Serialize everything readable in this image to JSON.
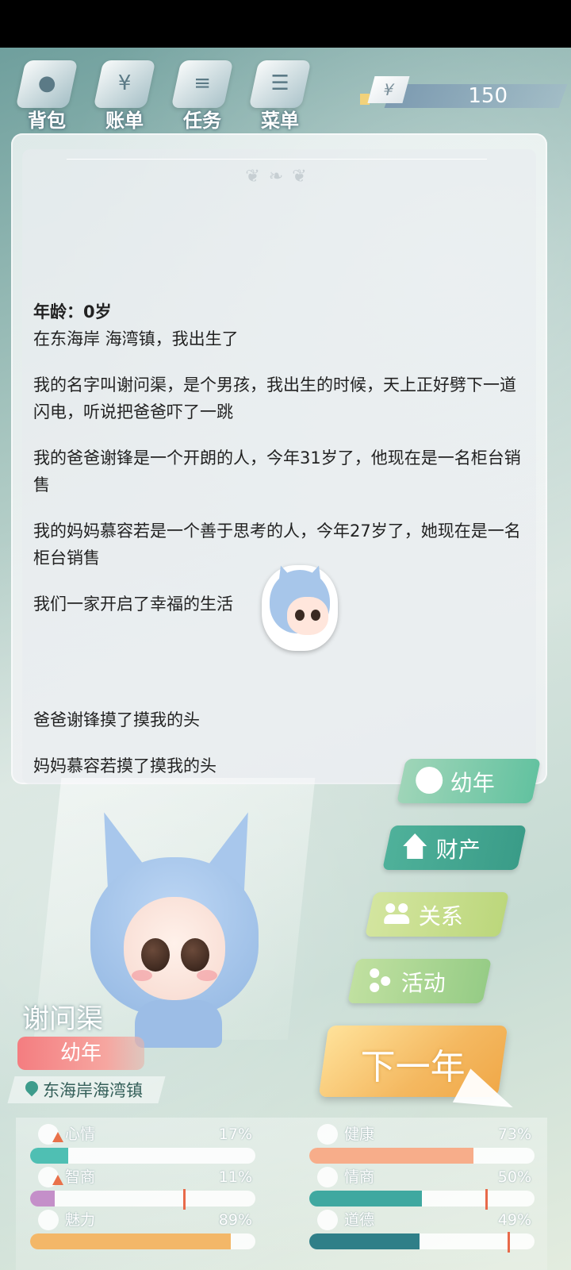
{
  "nav": {
    "items": [
      {
        "label": "背包",
        "icon": "backpack-icon",
        "glyph": "●"
      },
      {
        "label": "账单",
        "icon": "bill-icon",
        "glyph": "¥"
      },
      {
        "label": "任务",
        "icon": "task-icon",
        "glyph": "≡"
      },
      {
        "label": "菜单",
        "icon": "menu-icon",
        "glyph": "☰"
      }
    ]
  },
  "money": {
    "symbol": "¥",
    "value": "150"
  },
  "story": {
    "age": "年龄：0岁",
    "paragraphs": [
      "在东海岸 海湾镇，我出生了",
      "我的名字叫谢问渠，是个男孩，我出生的时候，天上正好劈下一道闪电，听说把爸爸吓了一跳",
      "我的爸爸谢锋是一个开朗的人，今年31岁了，他现在是一名柜台销售",
      "我的妈妈慕容若是一个善于思考的人，今年27岁了，她现在是一名柜台销售",
      "我们一家开启了幸福的生活"
    ],
    "after": [
      "爸爸谢锋摸了摸我的头",
      "妈妈慕容若摸了摸我的头"
    ]
  },
  "character": {
    "name": "谢问渠",
    "stage": "幼年",
    "location": "东海岸海湾镇"
  },
  "menu": {
    "child": "幼年",
    "asset": "财产",
    "relation": "关系",
    "activity": "活动",
    "next_year": "下一年"
  },
  "stats": [
    {
      "label": "心情",
      "pct": "17%",
      "value": 0.17,
      "color": "#4fbfb3",
      "icon": "smile-icon",
      "warn": true,
      "marker": null
    },
    {
      "label": "健康",
      "pct": "73%",
      "value": 0.73,
      "color": "#f7ad8a",
      "icon": "heart-icon",
      "warn": false,
      "marker": null
    },
    {
      "label": "智商",
      "pct": "11%",
      "value": 0.11,
      "color": "#c48fc9",
      "icon": "brain-icon",
      "warn": true,
      "marker": 0.68
    },
    {
      "label": "情商",
      "pct": "50%",
      "value": 0.5,
      "color": "#3fa8a0",
      "icon": "apple-icon",
      "warn": false,
      "marker": 0.78
    },
    {
      "label": "魅力",
      "pct": "89%",
      "value": 0.89,
      "color": "#f3b768",
      "icon": "sparkle-icon",
      "warn": false,
      "marker": null
    },
    {
      "label": "道德",
      "pct": "49%",
      "value": 0.49,
      "color": "#2f7f88",
      "icon": "scale-icon",
      "warn": false,
      "marker": 0.88
    }
  ]
}
